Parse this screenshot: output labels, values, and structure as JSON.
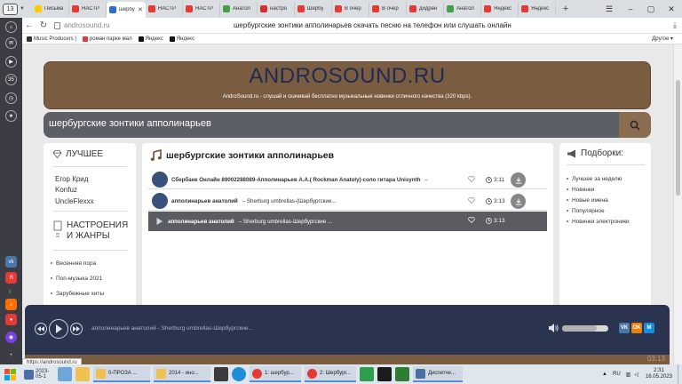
{
  "browser": {
    "tab_count": "13",
    "tabs": [
      {
        "label": "Письма",
        "color": "#ffcc00"
      },
      {
        "label": "НАСТР",
        "color": "#e53935"
      },
      {
        "label": "шербу",
        "color": "#2b6cd4",
        "active": true
      },
      {
        "label": "НАСТР",
        "color": "#e53935"
      },
      {
        "label": "НАСТР",
        "color": "#e53935"
      },
      {
        "label": "Анатол",
        "color": "#43a047"
      },
      {
        "label": "настро",
        "color": "#d32f2f"
      },
      {
        "label": "Шербу",
        "color": "#e53935"
      },
      {
        "label": "В очер",
        "color": "#e53935"
      },
      {
        "label": "В очер",
        "color": "#e53935"
      },
      {
        "label": "дидрен",
        "color": "#e53935"
      },
      {
        "label": "Анатол",
        "color": "#43a047"
      },
      {
        "label": "Яндекс",
        "color": "#e53935"
      },
      {
        "label": "Яндекс",
        "color": "#e53935"
      }
    ],
    "url": "androsound.ru",
    "page_title": "шербургские зонтики апполинарьев скачать песню на телефон или слушать онлайн",
    "bookmarks": [
      {
        "label": "Music Producers |",
        "color": "#333"
      },
      {
        "label": "роман парке мал",
        "color": "#e53935"
      },
      {
        "label": "Яндекс",
        "color": "#111"
      },
      {
        "label": "Яндекс",
        "color": "#111"
      }
    ],
    "bookmarks_other": "Другое",
    "status_url": "https://androsound.ru"
  },
  "site": {
    "logo": "ANDROSOUND.RU",
    "tagline": "AndroSound.ru - слушай и скачивай бесплатно музыкальные новинки отличного качества (320 kbps).",
    "search_value": "шербургские зонтики апполинарьев",
    "left": {
      "best_title": "ЛУЧШЕЕ",
      "artists": [
        "Егор Крид",
        "Konfuz",
        "UncleFlexxx"
      ],
      "moods_title_1": "НАСТРОЕНИЯ",
      "moods_title_2": "И ЖАНРЫ",
      "moods": [
        "Весенняя пора",
        "Поп-музыка 2021",
        "Зарубежные хиты"
      ]
    },
    "main": {
      "title": "шербургские зонтики апполинарьев",
      "tracks": [
        {
          "artist": "Сбербанк Онлайн 89002288089-Апполинарьев А.А.( Rockman Anatoly)-соло гитара Unisynth",
          "title": "",
          "duration": "3:11"
        },
        {
          "artist": "апполинарьев анатолий",
          "title": "Sherburg umbrellas-(Шербургские...",
          "duration": "3:13"
        },
        {
          "artist": "апполинарьев анатолий",
          "title": "Sherburg umbrellas-Шербургские ...",
          "duration": "3:13"
        }
      ]
    },
    "right": {
      "title": "Подборки:",
      "items": [
        "Лучшее за неделю",
        "Новинки",
        "Новые имена",
        "Популярное",
        "Новинки электроники"
      ]
    }
  },
  "player": {
    "now_playing": "апполинарьев анатолий - Sherburg umbrellas-Шербургские...",
    "time": "03:13",
    "volume": 0.75,
    "social": [
      {
        "label": "VK",
        "color": "#4a76a8"
      },
      {
        "label": "OK",
        "color": "#ee8208"
      },
      {
        "label": "M",
        "color": "#168de2"
      }
    ]
  },
  "taskbar": {
    "date_task": "2023-05-1",
    "tasks": [
      {
        "label": "0-ПРОЗА ..."
      },
      {
        "label": "2014 - ино..."
      },
      {
        "label": "1: шербур..."
      },
      {
        "label": "2: Шербург..."
      },
      {
        "label": "Диспетче..."
      }
    ],
    "lang": "RU",
    "time": "2:31",
    "date": "16.05.2023"
  }
}
